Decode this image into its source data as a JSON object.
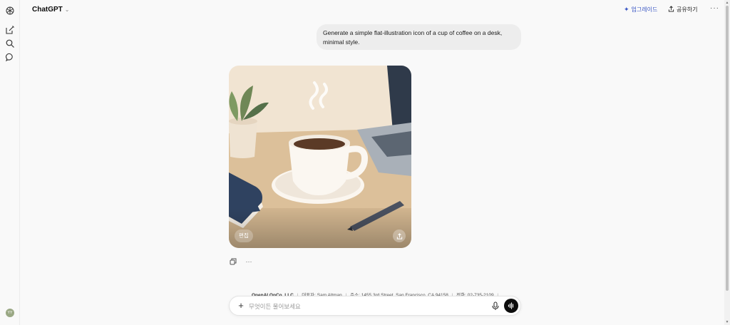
{
  "app": {
    "model_name": "ChatGPT",
    "upgrade_label": "업그레이드",
    "share_label": "공유하기",
    "more_label": "···"
  },
  "sidebar": {
    "icons": [
      "openai-logo-icon",
      "new-chat-icon",
      "search-icon",
      "chat-bubble-icon"
    ],
    "avatar_initials": "YY"
  },
  "conversation": {
    "user_message": "Generate a simple flat-illustration icon of a cup of coffee on a desk, minimal style.",
    "image": {
      "edit_label": "편집"
    }
  },
  "legal": {
    "company": "OpenAI OpCo, LLC",
    "ceo": "대표자: Sam Altman",
    "address": "주소: 1455 3rd Street, San Francisco, CA 94158",
    "phone": "전화: 02-735-2109"
  },
  "composer": {
    "placeholder": "무엇이든 물어보세요"
  },
  "colors": {
    "accent": "#3b57c4",
    "background": "#f9f9f9"
  }
}
